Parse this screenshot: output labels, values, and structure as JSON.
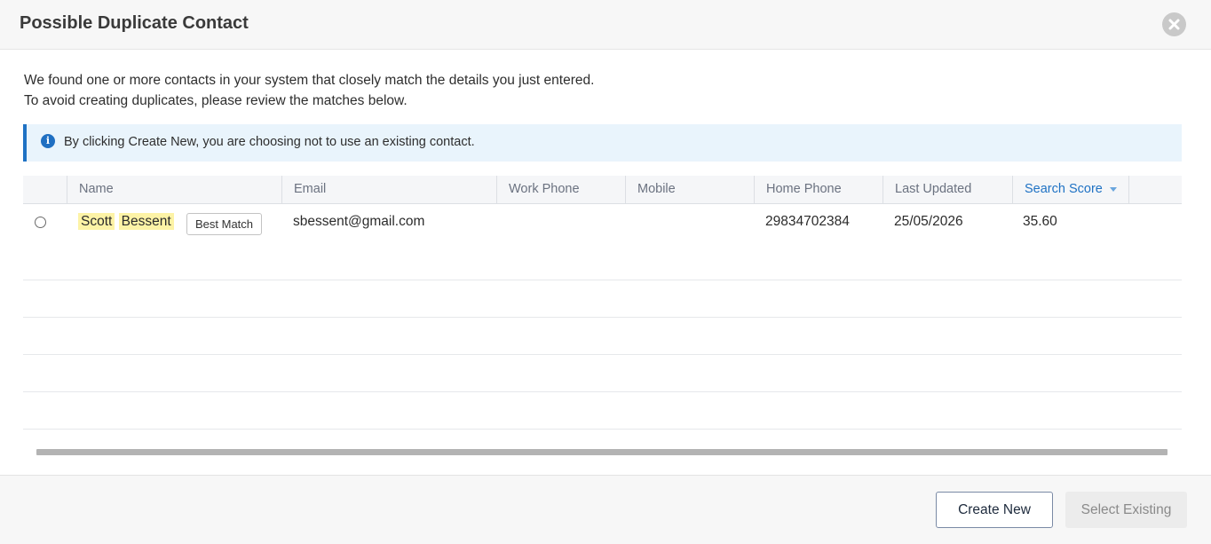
{
  "dialog": {
    "title": "Possible Duplicate Contact",
    "intro_line1": "We found one or more contacts in your system that closely match the details you just entered.",
    "intro_line2": "To avoid creating duplicates, please review the matches below.",
    "notice": "By clicking Create New, you are choosing not to use an existing contact."
  },
  "grid": {
    "columns": [
      "Name",
      "Email",
      "Work Phone",
      "Mobile",
      "Home Phone",
      "Last Updated",
      "Search Score"
    ],
    "sorted_column": "Search Score",
    "rows": [
      {
        "first_name": "Scott",
        "last_name": "Bessent",
        "badge": "Best Match",
        "email": "sbessent@gmail.com",
        "work_phone": "",
        "mobile": "",
        "home_phone": "29834702384",
        "last_updated": "25/05/2026",
        "search_score": "35.60",
        "selected": false
      }
    ]
  },
  "footer": {
    "create_label": "Create New",
    "select_label": "Select Existing"
  },
  "colors": {
    "accent": "#1f72c4",
    "highlight": "#fdf3a6",
    "notice_bg": "#e9f4fc"
  }
}
